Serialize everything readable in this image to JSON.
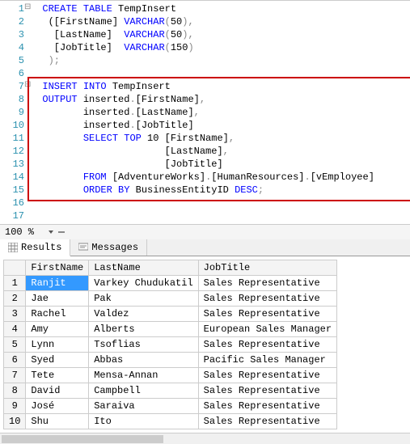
{
  "editor": {
    "lines": [
      {
        "n": 1,
        "segs": [
          {
            "t": "CREATE TABLE",
            "c": "kw"
          },
          {
            "t": " TempInsert",
            "c": "txt"
          }
        ]
      },
      {
        "n": 2,
        "segs": [
          {
            "t": "([FirstName] ",
            "c": "txt"
          },
          {
            "t": "VARCHAR",
            "c": "kw"
          },
          {
            "t": "(",
            "c": "gray"
          },
          {
            "t": "50",
            "c": "txt"
          },
          {
            "t": "),",
            "c": "gray"
          }
        ]
      },
      {
        "n": 3,
        "segs": [
          {
            "t": " [LastName]  ",
            "c": "txt"
          },
          {
            "t": "VARCHAR",
            "c": "kw"
          },
          {
            "t": "(",
            "c": "gray"
          },
          {
            "t": "50",
            "c": "txt"
          },
          {
            "t": "),",
            "c": "gray"
          }
        ]
      },
      {
        "n": 4,
        "segs": [
          {
            "t": " [JobTitle]  ",
            "c": "txt"
          },
          {
            "t": "VARCHAR",
            "c": "kw"
          },
          {
            "t": "(",
            "c": "gray"
          },
          {
            "t": "150",
            "c": "txt"
          },
          {
            "t": ")",
            "c": "gray"
          }
        ]
      },
      {
        "n": 5,
        "segs": [
          {
            "t": ");",
            "c": "gray"
          }
        ]
      },
      {
        "n": 6,
        "segs": []
      },
      {
        "n": 7,
        "segs": [
          {
            "t": "INSERT INTO",
            "c": "kw"
          },
          {
            "t": " TempInsert",
            "c": "txt"
          }
        ]
      },
      {
        "n": 8,
        "segs": [
          {
            "t": "OUTPUT",
            "c": "kw"
          },
          {
            "t": " inserted",
            "c": "txt"
          },
          {
            "t": ".",
            "c": "gray"
          },
          {
            "t": "[FirstName]",
            "c": "txt"
          },
          {
            "t": ",",
            "c": "gray"
          }
        ]
      },
      {
        "n": 9,
        "segs": [
          {
            "t": "       inserted",
            "c": "txt"
          },
          {
            "t": ".",
            "c": "gray"
          },
          {
            "t": "[LastName]",
            "c": "txt"
          },
          {
            "t": ",",
            "c": "gray"
          }
        ]
      },
      {
        "n": 10,
        "segs": [
          {
            "t": "       inserted",
            "c": "txt"
          },
          {
            "t": ".",
            "c": "gray"
          },
          {
            "t": "[JobTitle]",
            "c": "txt"
          }
        ]
      },
      {
        "n": 11,
        "segs": [
          {
            "t": "       ",
            "c": "txt"
          },
          {
            "t": "SELECT TOP",
            "c": "kw"
          },
          {
            "t": " 10 [FirstName]",
            "c": "txt"
          },
          {
            "t": ",",
            "c": "gray"
          }
        ]
      },
      {
        "n": 12,
        "segs": [
          {
            "t": "                     [LastName]",
            "c": "txt"
          },
          {
            "t": ",",
            "c": "gray"
          }
        ]
      },
      {
        "n": 13,
        "segs": [
          {
            "t": "                     [JobTitle]",
            "c": "txt"
          }
        ]
      },
      {
        "n": 14,
        "segs": [
          {
            "t": "       ",
            "c": "txt"
          },
          {
            "t": "FROM",
            "c": "kw"
          },
          {
            "t": " [AdventureWorks]",
            "c": "txt"
          },
          {
            "t": ".",
            "c": "gray"
          },
          {
            "t": "[HumanResources]",
            "c": "txt"
          },
          {
            "t": ".",
            "c": "gray"
          },
          {
            "t": "[vEmployee]",
            "c": "txt"
          }
        ]
      },
      {
        "n": 15,
        "segs": [
          {
            "t": "       ",
            "c": "txt"
          },
          {
            "t": "ORDER BY",
            "c": "kw"
          },
          {
            "t": " BusinessEntityID ",
            "c": "txt"
          },
          {
            "t": "DESC",
            "c": "kw"
          },
          {
            "t": ";",
            "c": "gray"
          }
        ]
      },
      {
        "n": 16,
        "segs": []
      },
      {
        "n": 17,
        "segs": []
      }
    ],
    "indent_offsets": {
      "1": 0,
      "2": 1,
      "3": 1,
      "4": 1,
      "5": 0,
      "6": 0,
      "7": 0,
      "8": 0,
      "9": 0,
      "10": 0,
      "11": 0,
      "12": 0,
      "13": 0,
      "14": 0,
      "15": 0,
      "16": 0,
      "17": 0
    }
  },
  "zoom": "100 %",
  "tabs": {
    "results": "Results",
    "messages": "Messages"
  },
  "grid": {
    "headers": [
      "FirstName",
      "LastName",
      "JobTitle"
    ],
    "rows": [
      [
        "Ranjit",
        "Varkey Chudukatil",
        "Sales Representative"
      ],
      [
        "Jae",
        "Pak",
        "Sales Representative"
      ],
      [
        "Rachel",
        "Valdez",
        "Sales Representative"
      ],
      [
        "Amy",
        "Alberts",
        "European Sales Manager"
      ],
      [
        "Lynn",
        "Tsoflias",
        "Sales Representative"
      ],
      [
        "Syed",
        "Abbas",
        "Pacific Sales Manager"
      ],
      [
        "Tete",
        "Mensa-Annan",
        "Sales Representative"
      ],
      [
        "David",
        "Campbell",
        "Sales Representative"
      ],
      [
        "José",
        "Saraiva",
        "Sales Representative"
      ],
      [
        "Shu",
        "Ito",
        "Sales Representative"
      ]
    ],
    "selected_cell": [
      0,
      0
    ]
  }
}
